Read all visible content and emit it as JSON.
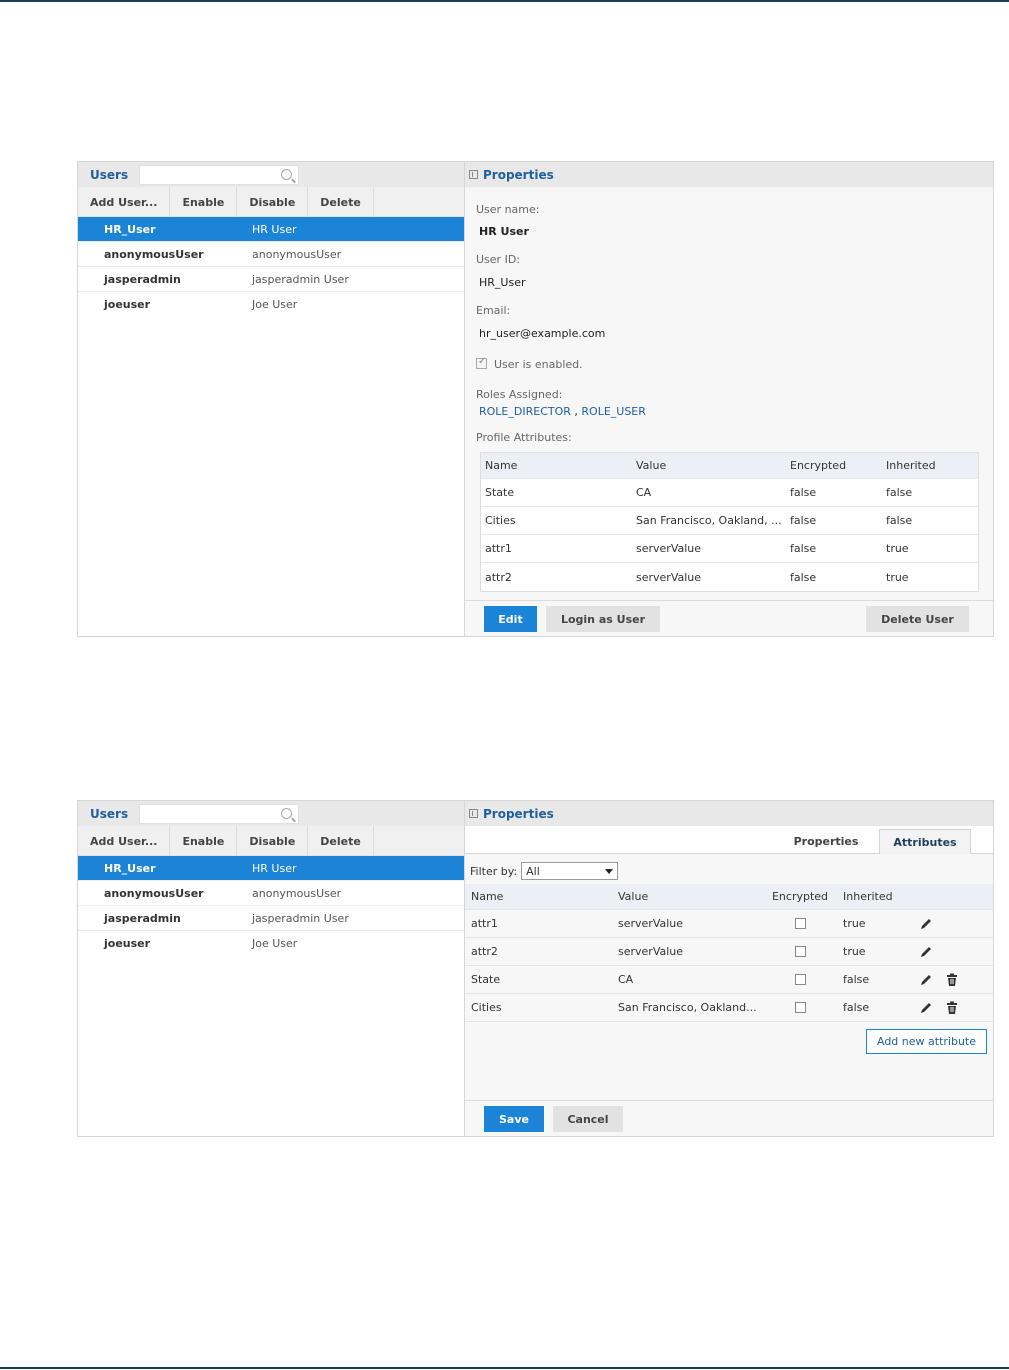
{
  "left_panel": {
    "title": "Users",
    "search_placeholder": "",
    "toolbar": [
      "Add User...",
      "Enable",
      "Disable",
      "Delete"
    ],
    "users": [
      {
        "id": "HR_User",
        "name": "HR User",
        "selected": true
      },
      {
        "id": "anonymousUser",
        "name": "anonymousUser"
      },
      {
        "id": "jasperadmin",
        "name": "jasperadmin User"
      },
      {
        "id": "joeuser",
        "name": "Joe User"
      }
    ]
  },
  "properties_view": {
    "title": "Properties",
    "user_name_label": "User name:",
    "user_name": "HR User",
    "user_id_label": "User ID:",
    "user_id": "HR_User",
    "email_label": "Email:",
    "email": "hr_user@example.com",
    "enabled_label": "User is enabled.",
    "roles_label": "Roles Assigned:",
    "role1": "ROLE_DIRECTOR",
    "role_sep": ",",
    "role2": "ROLE_USER",
    "profile_label": "Profile Attributes:",
    "columns": [
      "Name",
      "Value",
      "Encrypted",
      "Inherited"
    ],
    "rows": [
      [
        "State",
        "CA",
        "false",
        "false"
      ],
      [
        "Cities",
        "San Francisco, Oakland, ...",
        "false",
        "false"
      ],
      [
        "attr1",
        "serverValue",
        "false",
        "true"
      ],
      [
        "attr2",
        "serverValue",
        "false",
        "true"
      ]
    ],
    "buttons": {
      "edit": "Edit",
      "login_as": "Login as User",
      "delete_user": "Delete User"
    }
  },
  "attributes_view": {
    "title": "Properties",
    "tabs": [
      "Properties",
      "Attributes"
    ],
    "active_tab": "Attributes",
    "filter_label": "Filter by:",
    "filter_value": "All",
    "columns": [
      "Name",
      "Value",
      "Encrypted",
      "Inherited"
    ],
    "rows": [
      [
        "attr1",
        "serverValue",
        "true"
      ],
      [
        "attr2",
        "serverValue",
        "true"
      ],
      [
        "State",
        "CA",
        "false"
      ],
      [
        "Cities",
        "San Francisco, Oakland...",
        "false"
      ]
    ],
    "add_button": "Add new attribute",
    "buttons": {
      "save": "Save",
      "cancel": "Cancel"
    }
  },
  "colors": {
    "accent": "#1b84d7",
    "title_blue": "#1f5f9e",
    "header_bg": "#e8e8e8"
  }
}
